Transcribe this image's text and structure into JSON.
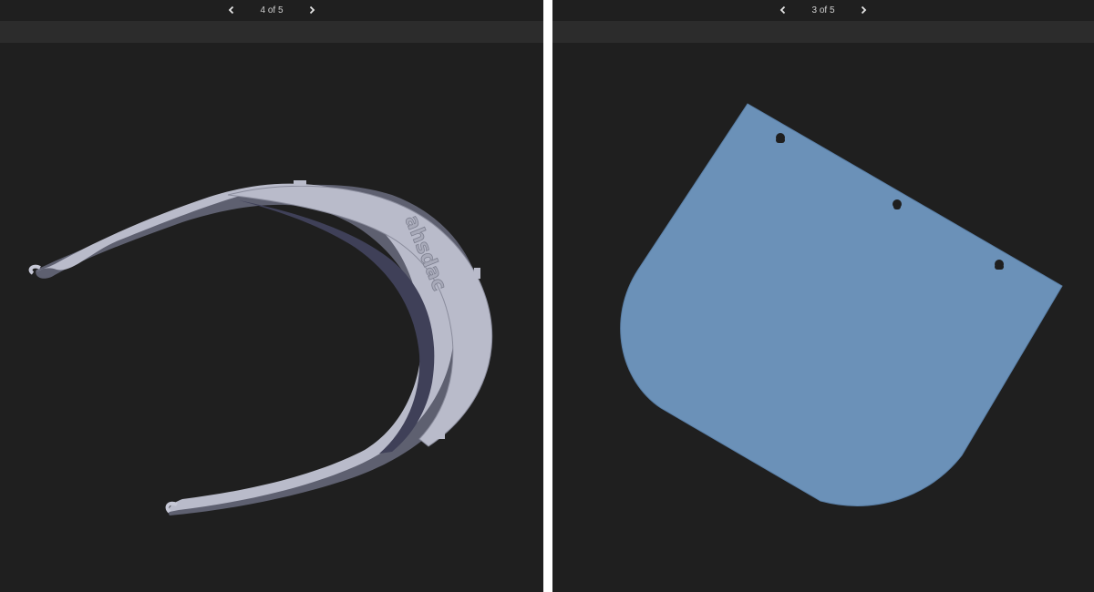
{
  "left_panel": {
    "pager": {
      "text": "4 of 5",
      "prev_icon": "chevron-left-icon",
      "next_icon": "chevron-right-icon"
    },
    "model": {
      "name": "face-shield-headband",
      "embossed_text": "ahsdac",
      "color": "#b9bbca"
    }
  },
  "right_panel": {
    "pager": {
      "text": "3 of 5",
      "prev_icon": "chevron-left-icon",
      "next_icon": "chevron-right-icon"
    },
    "model": {
      "name": "face-shield-visor",
      "color": "#6b91b8"
    }
  },
  "colors": {
    "background": "#1f1f1f",
    "toolbar": "#2c2c2c",
    "divider": "#ffffff"
  }
}
